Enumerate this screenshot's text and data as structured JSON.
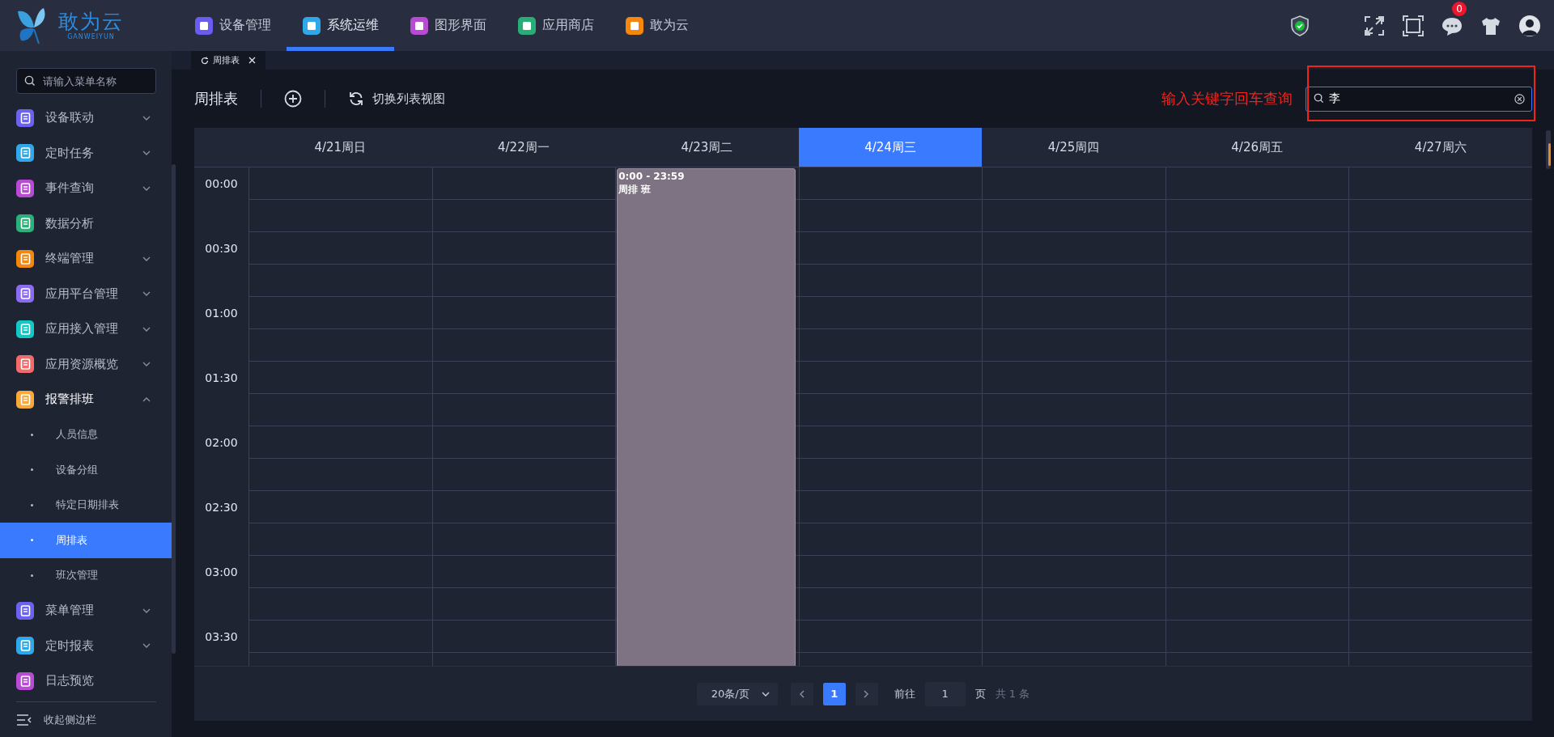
{
  "header": {
    "logo": {
      "name": "敢为云",
      "subtitle": "GANWEIYUN"
    },
    "nav": [
      {
        "label": "设备管理",
        "selected": false,
        "color": "#6a5cf0"
      },
      {
        "label": "系统运维",
        "selected": true,
        "color": "#2ea8e8"
      },
      {
        "label": "图形界面",
        "selected": false,
        "color": "#b84ad4"
      },
      {
        "label": "应用商店",
        "selected": false,
        "color": "#27ae78"
      },
      {
        "label": "敢为云",
        "selected": false,
        "color": "#f5870c"
      }
    ],
    "message_badge": "0"
  },
  "sidebar": {
    "search": {
      "placeholder": "请输入菜单名称"
    },
    "items": [
      {
        "label": "设备联动",
        "color": "#6b63f0",
        "expanded": false
      },
      {
        "label": "定时任务",
        "color": "#2ea8e8",
        "expanded": false
      },
      {
        "label": "事件查询",
        "color": "#b84ad4",
        "expanded": false
      },
      {
        "label": "数据分析",
        "color": "#2bb07c"
      },
      {
        "label": "终端管理",
        "color": "#f5870c",
        "expanded": false
      },
      {
        "label": "应用平台管理",
        "color": "#8b6cf0",
        "expanded": false
      },
      {
        "label": "应用接入管理",
        "color": "#14c7c7",
        "expanded": false
      },
      {
        "label": "应用资源概览",
        "color": "#f26b6b",
        "expanded": false
      },
      {
        "label": "报警排班",
        "color": "#f7a93a",
        "expanded": true,
        "children": [
          {
            "label": "人员信息",
            "selected": false
          },
          {
            "label": "设备分组",
            "selected": false
          },
          {
            "label": "特定日期排表",
            "selected": false
          },
          {
            "label": "周排表",
            "selected": true
          },
          {
            "label": "班次管理",
            "selected": false
          }
        ]
      },
      {
        "label": "菜单管理",
        "color": "#6b63f0",
        "expanded": false
      },
      {
        "label": "定时报表",
        "color": "#2ea8e8",
        "expanded": false
      },
      {
        "label": "日志预览",
        "color": "#b84ad4"
      }
    ],
    "collapse_label": "收起侧边栏"
  },
  "tabs": [
    {
      "label": "周排表",
      "selected": true
    }
  ],
  "toolbar": {
    "title": "周排表",
    "switch_label": "切换列表视图"
  },
  "annotation": {
    "text": "输入关键字回车查询"
  },
  "search": {
    "value": "李"
  },
  "calendar": {
    "days": [
      {
        "label": "4/21周日",
        "selected": false
      },
      {
        "label": "4/22周一",
        "selected": false
      },
      {
        "label": "4/23周二",
        "selected": false,
        "events": [
          {
            "time": "0:00 - 23:59",
            "title": "周排 班"
          }
        ]
      },
      {
        "label": "4/24周三",
        "selected": true
      },
      {
        "label": "4/25周四",
        "selected": false
      },
      {
        "label": "4/26周五",
        "selected": false
      },
      {
        "label": "4/27周六",
        "selected": false
      }
    ],
    "times": [
      "00:00",
      "00:30",
      "01:00",
      "01:30",
      "02:00",
      "02:30",
      "03:00",
      "03:30"
    ]
  },
  "pagination": {
    "page_size": "20条/页",
    "pages": [
      {
        "label": "1",
        "selected": true
      }
    ],
    "goto_label": "前往",
    "goto_value": "1",
    "page_unit": "页",
    "total": "共 1 条"
  }
}
